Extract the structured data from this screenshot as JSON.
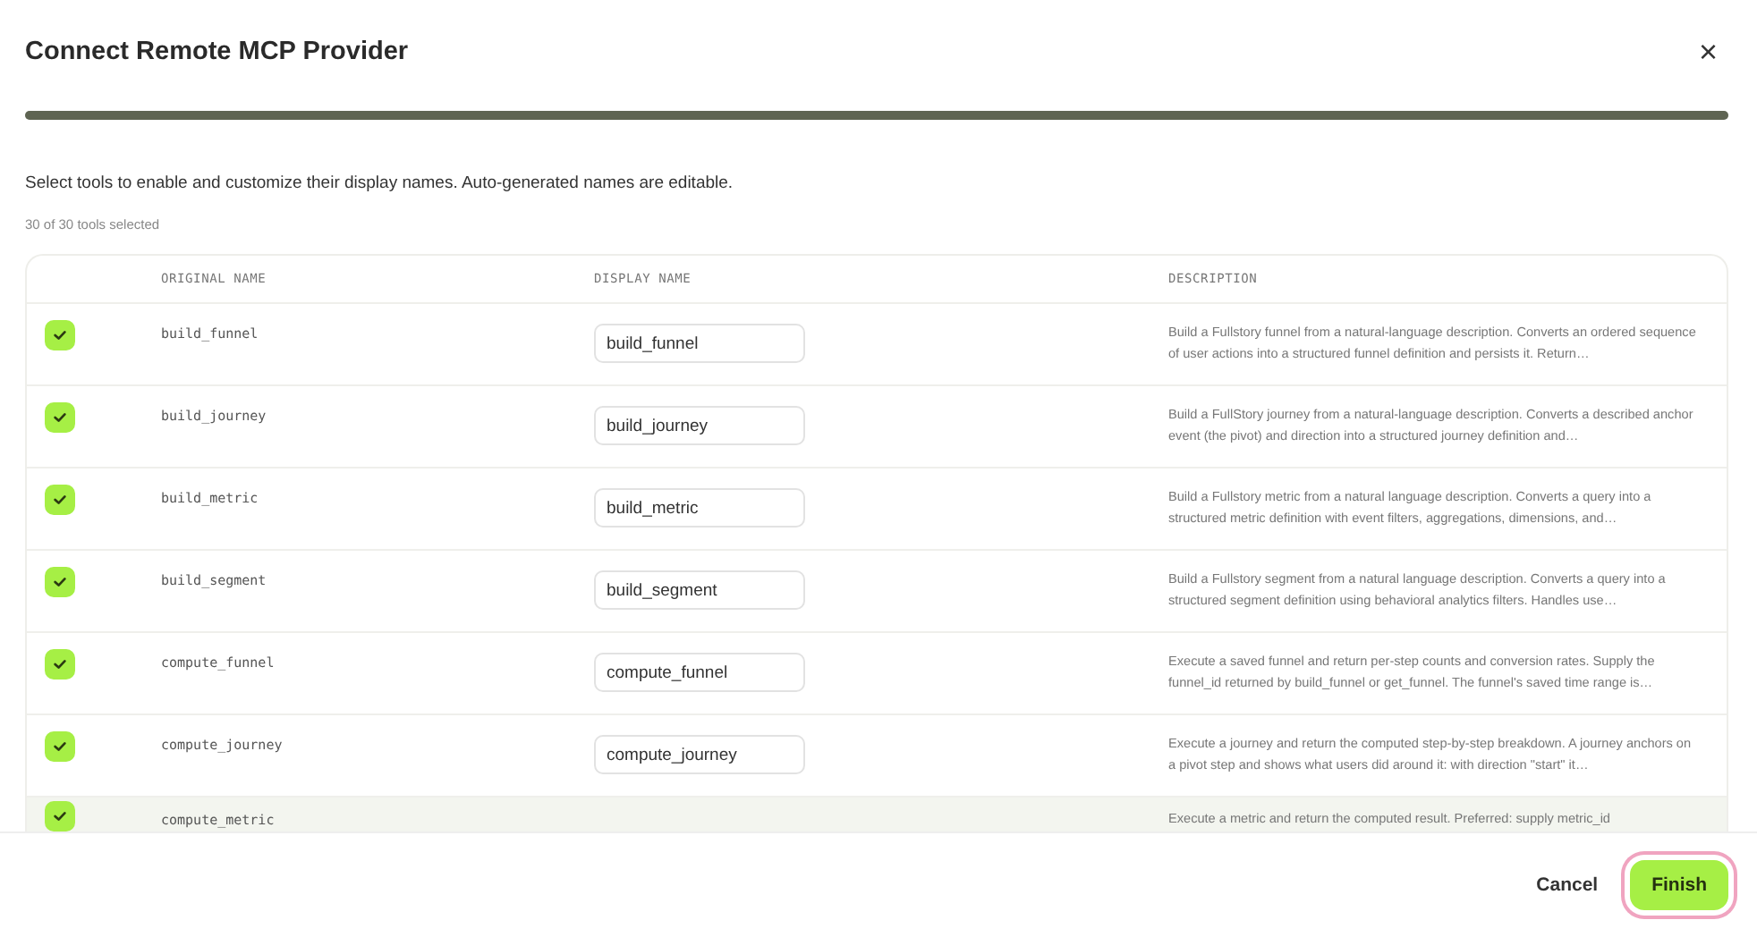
{
  "dialog": {
    "title": "Connect Remote MCP Provider",
    "close": "×"
  },
  "progress": {
    "level": 1
  },
  "intro": "Select tools to enable and customize their display names. Auto-generated names are editable.",
  "count": "30 of 30 tools selected",
  "table": {
    "columns": [
      "ORIGINAL NAME",
      "DISPLAY NAME",
      "DESCRIPTION"
    ],
    "rows": [
      {
        "checked": true,
        "hovered": false,
        "original_name": "build_funnel",
        "display_name": "build_funnel",
        "description": "Build a Fullstory funnel from a natural-language description. Converts an ordered sequence of user actions into a structured funnel definition and persists it. Return…"
      },
      {
        "checked": true,
        "hovered": false,
        "original_name": "build_journey",
        "display_name": "build_journey",
        "description": "Build a FullStory journey from a natural-language description. Converts a described anchor event (the pivot) and direction into a structured journey definition and…"
      },
      {
        "checked": true,
        "hovered": false,
        "original_name": "build_metric",
        "display_name": "build_metric",
        "description": "Build a Fullstory metric from a natural language description. Converts a query into a structured metric definition with event filters, aggregations, dimensions, and…"
      },
      {
        "checked": true,
        "hovered": false,
        "original_name": "build_segment",
        "display_name": "build_segment",
        "description": "Build a Fullstory segment from a natural language description. Converts a query into a structured segment definition using behavioral analytics filters. Handles use…"
      },
      {
        "checked": true,
        "hovered": false,
        "original_name": "compute_funnel",
        "display_name": "compute_funnel",
        "description": "Execute a saved funnel and return per-step counts and conversion rates. Supply the funnel_id returned by build_funnel or get_funnel. The funnel's saved time range is…"
      },
      {
        "checked": true,
        "hovered": false,
        "original_name": "compute_journey",
        "display_name": "compute_journey",
        "description": "Execute a journey and return the computed step-by-step breakdown. A journey anchors on a pivot step and shows what users did around it: with direction \"start\" it…"
      },
      {
        "checked": true,
        "hovered": true,
        "original_name": "compute_metric",
        "description": "Execute a metric and return the computed result. Preferred: supply metric_id"
      }
    ]
  },
  "buttons": [
    {
      "kind": "secondary",
      "label": "Cancel"
    },
    {
      "kind": "primary",
      "label": "Finish",
      "focused": true
    }
  ]
}
